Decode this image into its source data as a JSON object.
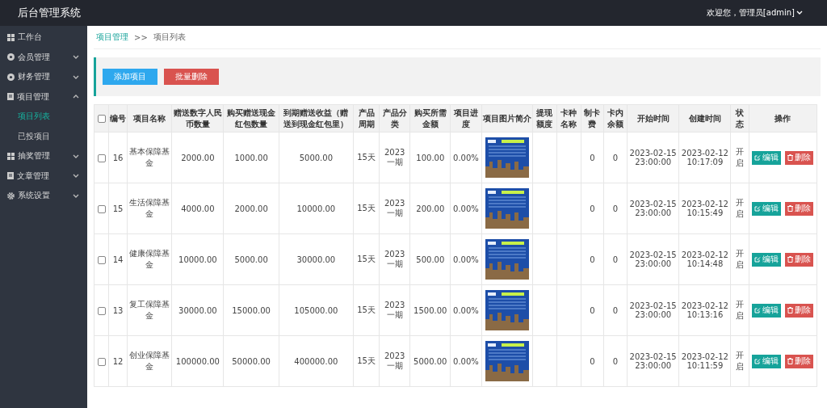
{
  "header": {
    "title": "后台管理系统",
    "user": "欢迎您，管理员[admin]"
  },
  "sidebar": {
    "items": [
      {
        "label": "工作台",
        "kind": "link"
      },
      {
        "label": "会员管理",
        "kind": "group",
        "expanded": false
      },
      {
        "label": "财务管理",
        "kind": "group",
        "expanded": false
      },
      {
        "label": "项目管理",
        "kind": "group",
        "expanded": true,
        "children": [
          {
            "label": "项目列表",
            "selected": true
          },
          {
            "label": "已投项目",
            "selected": false
          }
        ]
      },
      {
        "label": "抽奖管理",
        "kind": "group",
        "expanded": false
      },
      {
        "label": "文章管理",
        "kind": "group",
        "expanded": false
      },
      {
        "label": "系统设置",
        "kind": "group",
        "expanded": false
      }
    ]
  },
  "breadcrumb": {
    "parent": "项目管理",
    "separator": ">>",
    "current": "项目列表"
  },
  "toolbar": {
    "buttons": [
      {
        "label": "添加项目",
        "kind": "primary"
      },
      {
        "label": "批量删除",
        "kind": "danger"
      }
    ]
  },
  "table": {
    "select_all": {
      "checked": false
    },
    "columns": [
      "编号",
      "项目名称",
      "赠送数字人民币数量",
      "购买赠送现金红包数量",
      "到期赠送收益（赠送到现金红包里）",
      "产品周期",
      "产品分类",
      "购买所需金额",
      "项目进度",
      "项目图片简介",
      "提现额度",
      "卡种名称",
      "制卡费",
      "卡内余额",
      "开始时间",
      "创建时间",
      "状态",
      "操作"
    ],
    "rows": [
      {
        "checked": false,
        "cells": [
          "16",
          "基本保障基金",
          "2000.00",
          "1000.00",
          "5000.00",
          "15天",
          "2023一期",
          "100.00",
          "0.00%",
          "",
          "",
          "",
          "0",
          "0",
          "2023-02-15 23:00:00",
          "2023-02-12 10:17:09",
          "开启"
        ],
        "actions": [
          "编辑",
          "删除"
        ]
      },
      {
        "checked": false,
        "cells": [
          "15",
          "生活保障基金",
          "4000.00",
          "2000.00",
          "10000.00",
          "15天",
          "2023一期",
          "200.00",
          "0.00%",
          "",
          "",
          "",
          "0",
          "0",
          "2023-02-15 23:00:00",
          "2023-02-12 10:15:49",
          "开启"
        ],
        "actions": [
          "编辑",
          "删除"
        ]
      },
      {
        "checked": false,
        "cells": [
          "14",
          "健康保障基金",
          "10000.00",
          "5000.00",
          "30000.00",
          "15天",
          "2023一期",
          "500.00",
          "0.00%",
          "",
          "",
          "",
          "0",
          "0",
          "2023-02-15 23:00:00",
          "2023-02-12 10:14:48",
          "开启"
        ],
        "actions": [
          "编辑",
          "删除"
        ]
      },
      {
        "checked": false,
        "cells": [
          "13",
          "复工保障基金",
          "30000.00",
          "15000.00",
          "105000.00",
          "15天",
          "2023一期",
          "1500.00",
          "0.00%",
          "",
          "",
          "",
          "0",
          "0",
          "2023-02-15 23:00:00",
          "2023-02-12 10:13:16",
          "开启"
        ],
        "actions": [
          "编辑",
          "删除"
        ]
      },
      {
        "checked": false,
        "cells": [
          "12",
          "创业保障基金",
          "100000.00",
          "50000.00",
          "400000.00",
          "15天",
          "2023一期",
          "5000.00",
          "0.00%",
          "",
          "",
          "",
          "0",
          "0",
          "2023-02-15 23:00:00",
          "2023-02-12 10:11:59",
          "开启"
        ],
        "actions": [
          "编辑",
          "删除"
        ]
      }
    ]
  }
}
